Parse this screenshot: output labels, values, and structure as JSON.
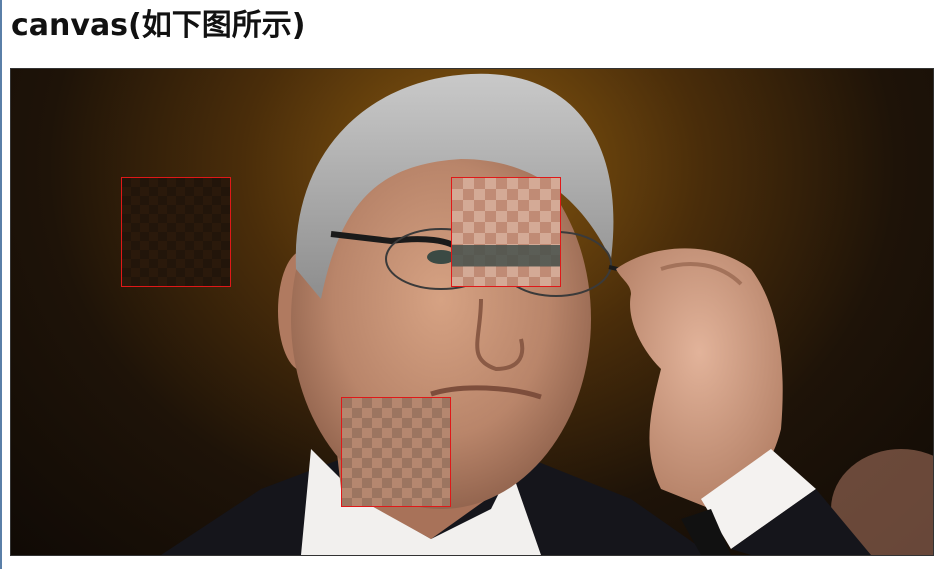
{
  "page": {
    "title": "canvas(如下图所示)"
  },
  "canvas": {
    "mosaic_regions": [
      {
        "name": "mosaic-background",
        "tile_colors": [
          "#3a2310",
          "#2e1b0c",
          "#26170a",
          "#1f1409"
        ]
      },
      {
        "name": "mosaic-eye",
        "tile_colors": [
          "#d9b4a2",
          "#c89680",
          "#b98a79",
          "#8a6a5f",
          "#5a5e58",
          "#e8d6c8"
        ]
      },
      {
        "name": "mosaic-mouth",
        "tile_colors": [
          "#b88870",
          "#a8806c",
          "#8f6b57",
          "#c9a18a",
          "#7a5a48",
          "#e0c0a8"
        ]
      }
    ],
    "highlight_color": "#e01818"
  }
}
